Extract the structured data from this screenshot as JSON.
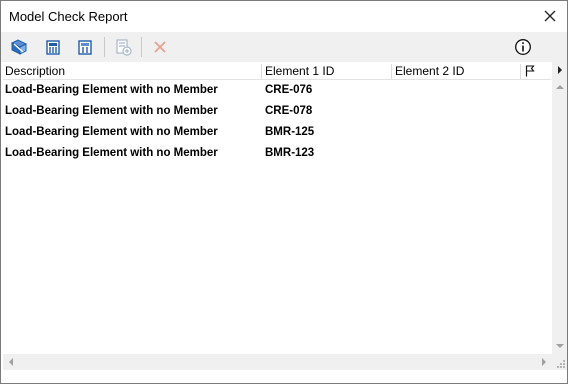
{
  "window": {
    "title": "Model Check Report"
  },
  "toolbar": {
    "buttons": [
      {
        "icon": "select-elements-icon",
        "enabled": true
      },
      {
        "icon": "open-3d-view-icon",
        "enabled": true
      },
      {
        "icon": "open-section-view-icon",
        "enabled": true
      },
      {
        "icon": "add-to-issue-icon",
        "enabled": false
      },
      {
        "icon": "delete-icon",
        "enabled": false
      },
      {
        "icon": "info-icon",
        "enabled": true
      }
    ]
  },
  "table": {
    "columns": [
      "Description",
      "Element 1 ID",
      "Element 2 ID",
      ""
    ],
    "flag_icon": "flag-icon",
    "rows": [
      {
        "description": "Load-Bearing Element with no Member",
        "element1": "CRE-076",
        "element2": ""
      },
      {
        "description": "Load-Bearing Element with no Member",
        "element1": "CRE-078",
        "element2": ""
      },
      {
        "description": "Load-Bearing Element with no Member",
        "element1": "BMR-125",
        "element2": ""
      },
      {
        "description": "Load-Bearing Element with no Member",
        "element1": "BMR-123",
        "element2": ""
      }
    ]
  },
  "colors": {
    "toolbar_icon_blue": "#1f5fa8",
    "disabled_icon": "#a8b8c8",
    "delete_disabled": "#e8a090",
    "toolbar_bg": "#f0f0f0"
  }
}
